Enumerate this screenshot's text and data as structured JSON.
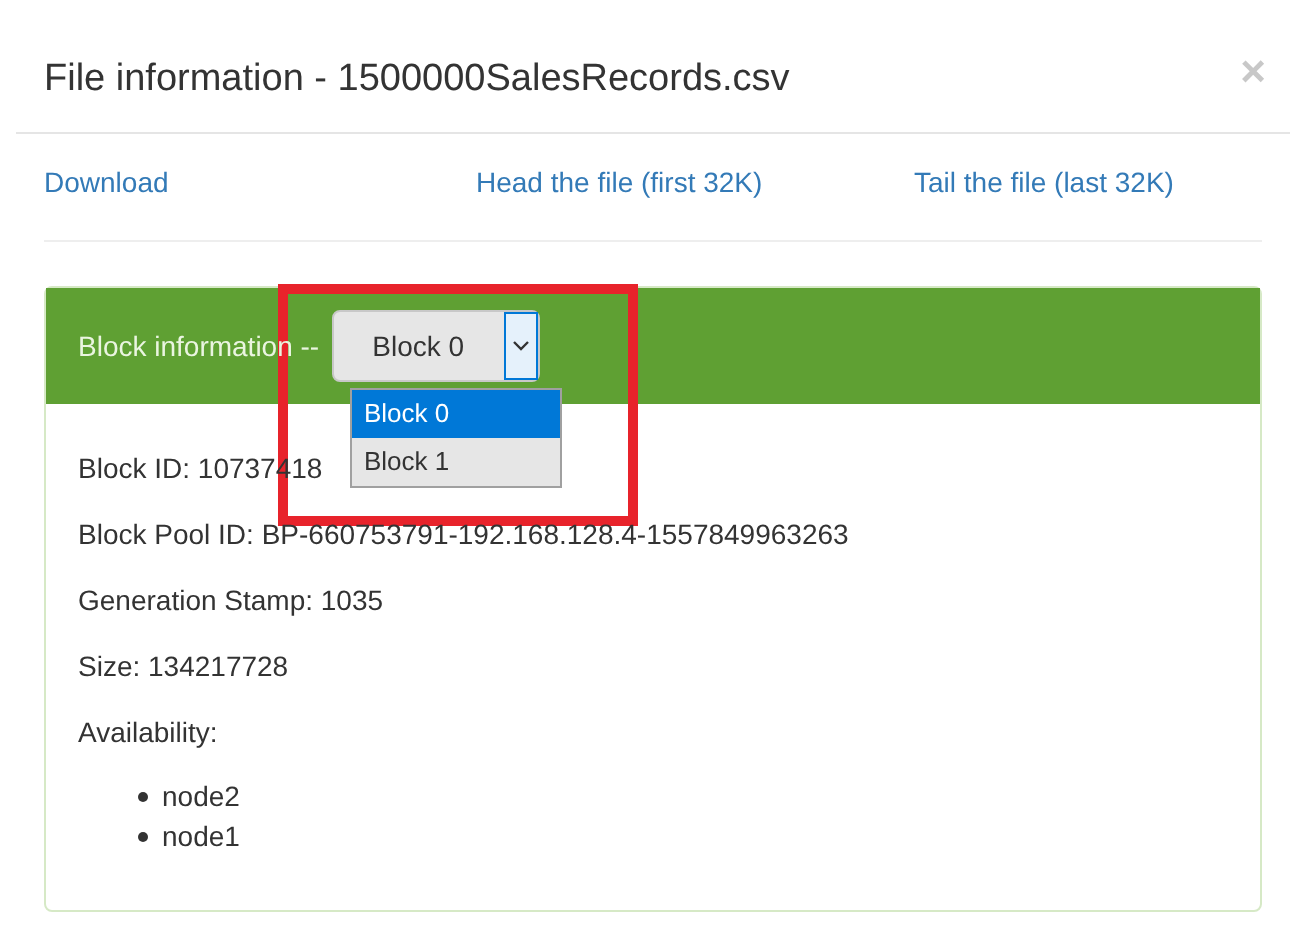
{
  "dialog": {
    "title": "File information - 1500000SalesRecords.csv",
    "close": "×"
  },
  "links": [
    "Download",
    "Head the file (first 32K)",
    "Tail the file (last 32K)"
  ],
  "panel": {
    "heading": "Block information --",
    "select": {
      "value": "Block 0",
      "open": true,
      "options": [
        {
          "label": "Block 0",
          "selected": true
        },
        {
          "label": "Block 1",
          "selected": false
        }
      ]
    },
    "fields": [
      "Block ID: 10737418",
      "Block Pool ID: BP-660753791-192.168.128.4-1557849963263",
      "Generation Stamp: 1035",
      "Size: 134217728"
    ],
    "availability": {
      "label": "Availability:",
      "nodes": [
        "node2",
        "node1"
      ]
    }
  },
  "highlight": true
}
